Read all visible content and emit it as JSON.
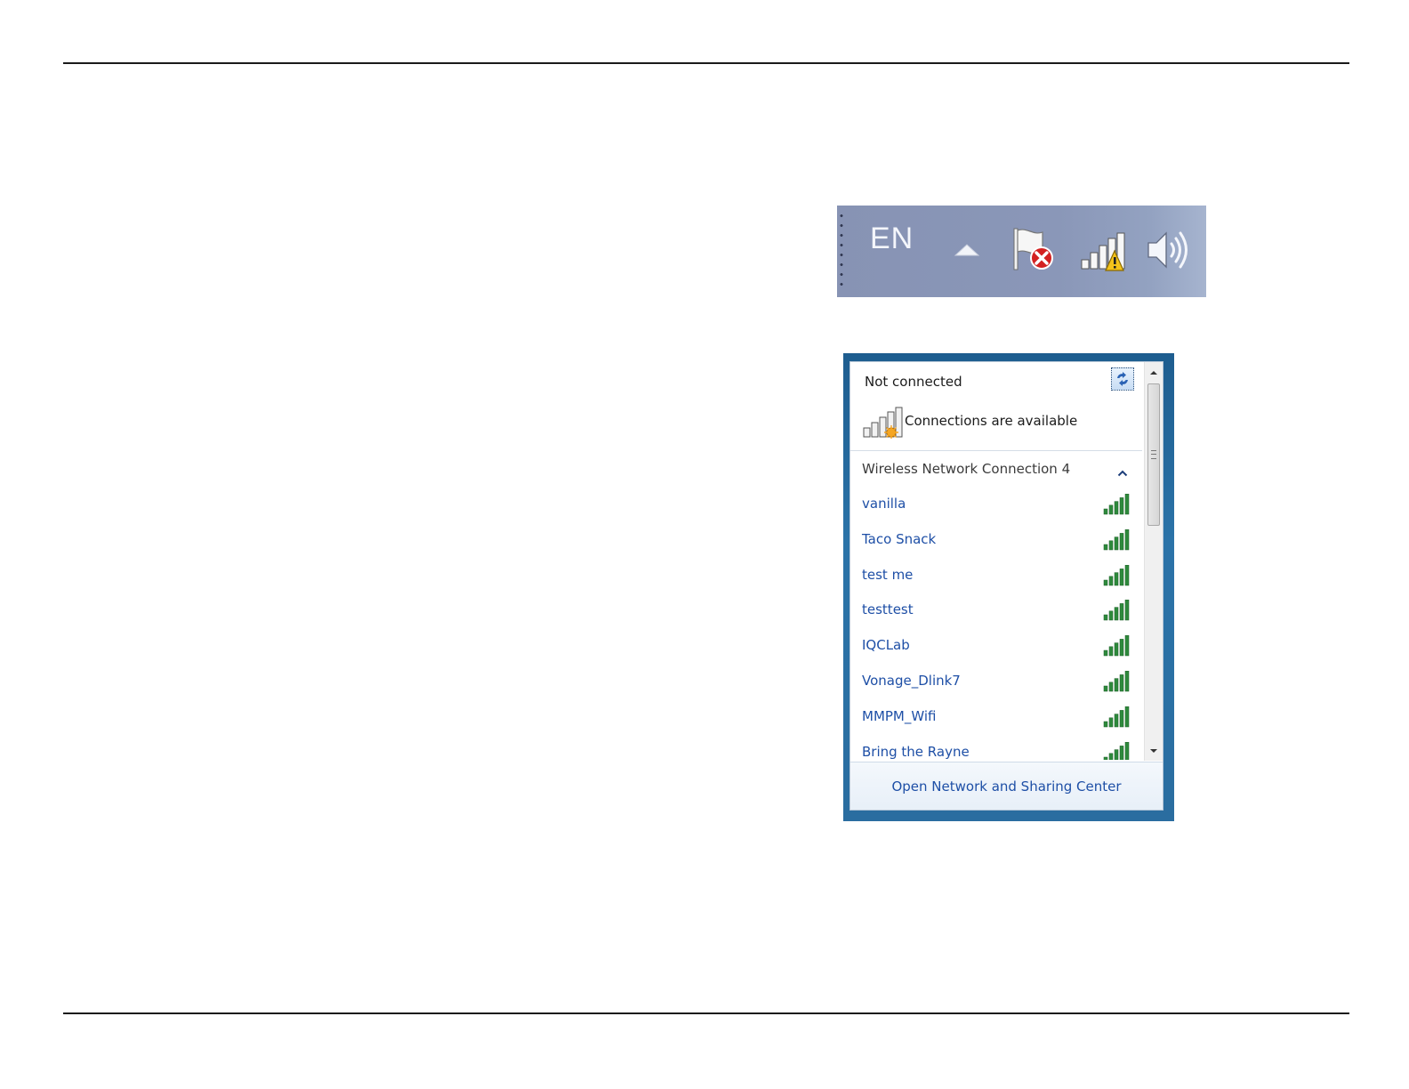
{
  "tray": {
    "language": "EN",
    "icons": [
      "show-hidden-icons-arrow-icon",
      "action-center-flag-error-icon",
      "network-warning-icon",
      "volume-icon"
    ]
  },
  "flyout": {
    "status_title": "Not connected",
    "availability": "Connections are available",
    "section_title": "Wireless Network Connection 4",
    "networks": [
      {
        "name": "vanilla",
        "signal": 5
      },
      {
        "name": "Taco Snack",
        "signal": 5
      },
      {
        "name": "test me",
        "signal": 5
      },
      {
        "name": "testtest",
        "signal": 5
      },
      {
        "name": "IQCLab",
        "signal": 5
      },
      {
        "name": "Vonage_Dlink7",
        "signal": 5
      },
      {
        "name": "MMPM_Wifi",
        "signal": 5
      },
      {
        "name": "Bring the Rayne",
        "signal": 5
      }
    ],
    "footer_link": "Open Network and Sharing Center"
  },
  "colors": {
    "link": "#1e4fa6",
    "signal": "#2e8a3c",
    "tray_bg": "#8a97b8",
    "flyout_frame": "#2b73a8"
  }
}
